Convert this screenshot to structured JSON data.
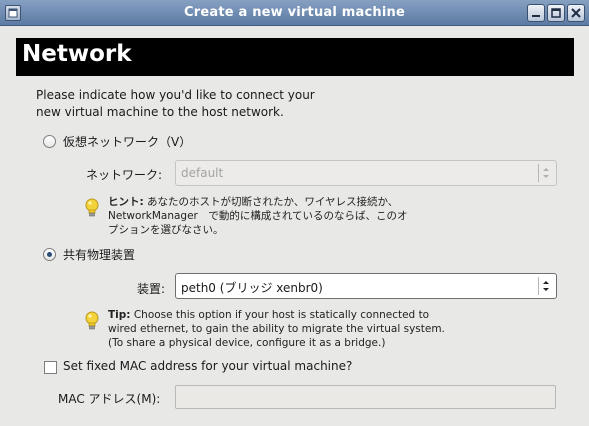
{
  "window": {
    "title": "Create a new virtual machine"
  },
  "page": {
    "heading": "Network",
    "intro_line1": "Please indicate how you'd like to connect your",
    "intro_line2": "new virtual machine to the host network."
  },
  "virtual_network": {
    "radio_label": "仮想ネットワーク（V）",
    "network_label": "ネットワーク:",
    "network_value": "default",
    "checked": false,
    "hint_title": "ヒント:",
    "hint_line1": "あなたのホストが切断されたか、ワイヤレス接続か、",
    "hint_line2": "NetworkManager　で動的に構成されているのならば、このオ",
    "hint_line3": "プションを選びなさい。"
  },
  "shared_device": {
    "radio_label": "共有物理装置",
    "device_label": "装置:",
    "device_value": "peth0 (ブリッジ  xenbr0)",
    "checked": true,
    "tip_title": "Tip:",
    "tip_line1": "Choose this option if your host is statically connected to",
    "tip_line2": "wired ethernet, to gain the ability to migrate the virtual system.",
    "tip_line3": "(To share a physical device, configure it as a bridge.)"
  },
  "mac": {
    "checkbox_label": "Set fixed MAC address for your virtual machine?",
    "checked": false,
    "field_label": "MAC アドレス(M):",
    "field_value": ""
  },
  "icons": {
    "menu": "window-menu-icon",
    "minimize": "minimize-icon",
    "maximize": "maximize-icon",
    "close": "close-icon",
    "hint": "lightbulb-icon",
    "combo_arrows": "spin-arrows-icon"
  },
  "colors": {
    "titlebar": "#6f8bb2",
    "banner": "#000000",
    "window_bg": "#e8e8e7",
    "bulb": "#f3d23a"
  }
}
